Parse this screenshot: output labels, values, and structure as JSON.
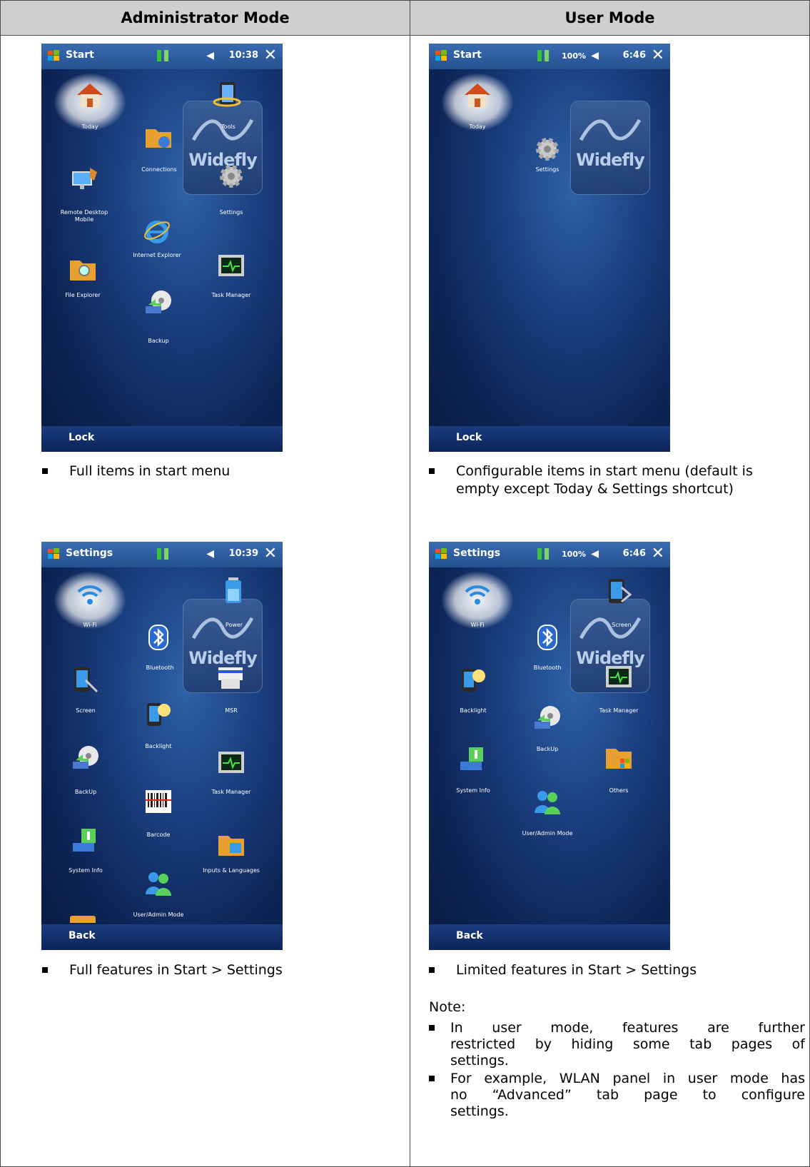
{
  "table": {
    "headers": {
      "admin": "Administrator Mode",
      "user": "User Mode"
    }
  },
  "screens": {
    "admin_start": {
      "title": "Start",
      "time": "10:38",
      "softkey": "Lock",
      "logo_text": "Widefly",
      "items": [
        "Today",
        "Tools",
        "Connections",
        "Remote Desktop Mobile",
        "Settings",
        "Internet Explorer",
        "File Explorer",
        "Task Manager",
        "Backup"
      ]
    },
    "user_start": {
      "title": "Start",
      "time": "6:46",
      "battery": "100%",
      "softkey": "Lock",
      "logo_text": "Widefly",
      "items": [
        "Today",
        "Settings"
      ]
    },
    "admin_settings": {
      "title": "Settings",
      "time": "10:39",
      "softkey": "Back",
      "logo_text": "Widefly",
      "items": [
        "Wi-Fi",
        "Power",
        "Bluetooth",
        "Screen",
        "MSR",
        "Backlight",
        "BackUp",
        "Task Manager",
        "Barcode",
        "System Info",
        "Inputs & Languages",
        "User/Admin Mode"
      ]
    },
    "user_settings": {
      "title": "Settings",
      "time": "6:46",
      "battery": "100%",
      "softkey": "Back",
      "logo_text": "Widefly",
      "items": [
        "Wi-Fi",
        "Screen",
        "Bluetooth",
        "Backlight",
        "Task Manager",
        "BackUp",
        "System Info",
        "Others",
        "User/Admin Mode"
      ]
    }
  },
  "captions": {
    "admin_start": "Full items in start menu",
    "user_start_line1": "Configurable items in start menu (default is",
    "user_start_line2": "empty except Today & Settings shortcut)",
    "admin_settings": "Full features in Start > Settings",
    "user_settings": "Limited features in Start > Settings"
  },
  "note": {
    "heading": "Note:",
    "b1_l1": "In user mode, features are further",
    "b1_l2": "restricted by hiding some tab pages of",
    "b1_l3": "settings.",
    "b2_l1": "For example, WLAN panel in user mode has",
    "b2_l2": "no “Advanced” tab page to configure",
    "b2_l3": "settings."
  }
}
